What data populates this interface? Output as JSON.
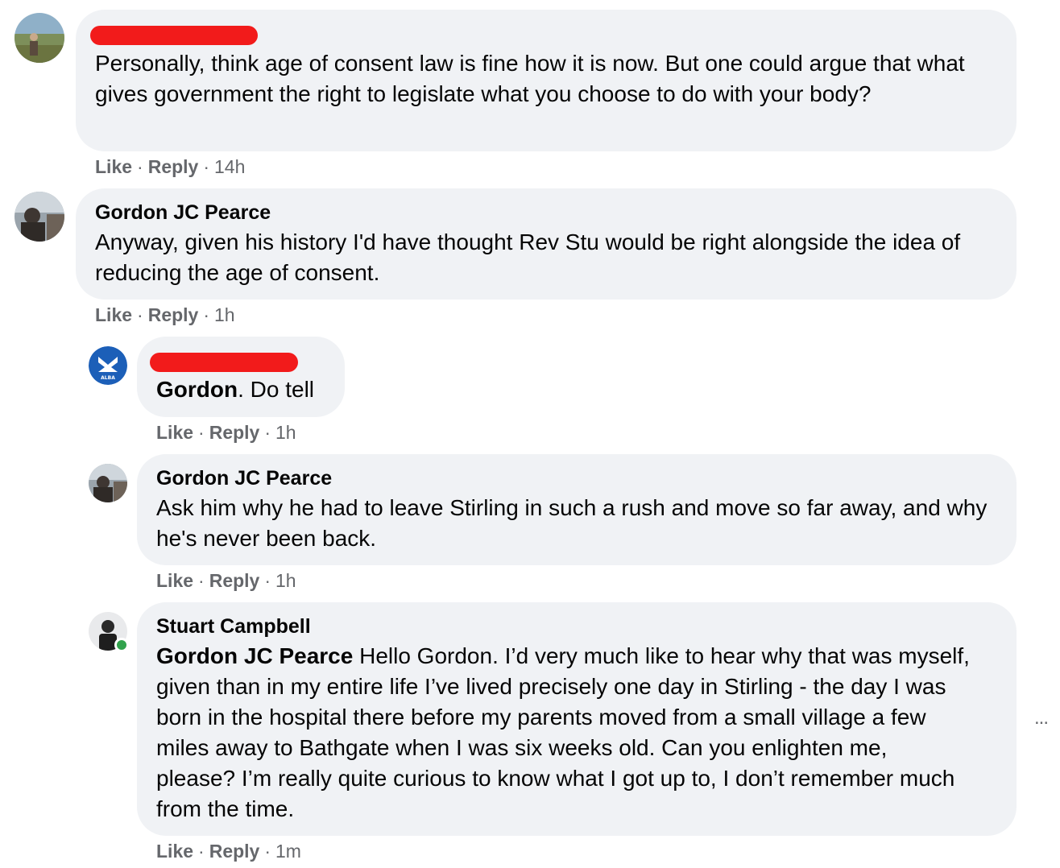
{
  "comments": [
    {
      "text": "Personally, think age of consent law is fine how it is now. But one could argue that what gives government the right to legislate what you choose to do with your body?",
      "actions": {
        "like": "Like",
        "reply": "Reply",
        "time": "14h"
      }
    },
    {
      "author": "Gordon JC Pearce",
      "text": "Anyway, given his history I'd have thought Rev Stu would be right alongside the idea of reducing the age of consent.",
      "actions": {
        "like": "Like",
        "reply": "Reply",
        "time": "1h"
      }
    },
    {
      "mention": "Gordon",
      "text": ". Do tell",
      "avatar_label": "ALBA",
      "actions": {
        "like": "Like",
        "reply": "Reply",
        "time": "1h"
      }
    },
    {
      "author": "Gordon JC Pearce",
      "text": "Ask him why he had to leave Stirling in such a rush and move so far away, and why he's never been back.",
      "actions": {
        "like": "Like",
        "reply": "Reply",
        "time": "1h"
      }
    },
    {
      "author": "Stuart Campbell",
      "mention": "Gordon JC Pearce",
      "text": " Hello Gordon. I’d very much like to hear why that was myself, given than in my entire life I’ve lived precisely one day in Stirling - the day I was born in the hospital there before my parents moved from a small village a few miles away to Bathgate when I was six weeks old. Can you enlighten me, please? I’m really quite curious to know what I got up to, I don’t remember much from the time.",
      "actions": {
        "like": "Like",
        "reply": "Reply",
        "time": "1m"
      }
    }
  ],
  "more_options": "...",
  "colors": {
    "bubble": "#f0f2f5",
    "redaction": "#f21b1b",
    "meta": "#65676b",
    "online": "#31a24c",
    "alba_blue": "#1c5fb8"
  }
}
